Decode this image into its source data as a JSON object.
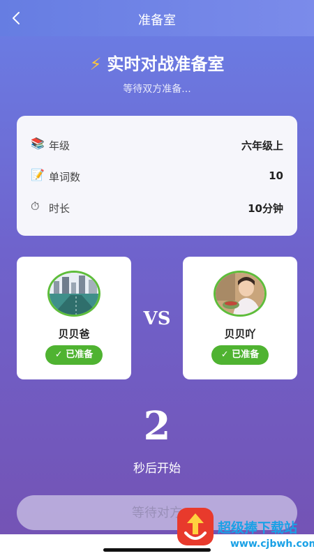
{
  "header": {
    "title": "准备室"
  },
  "hero": {
    "icon": "lightning-icon",
    "title": "实时对战准备室",
    "subtitle": "等待双方准备..."
  },
  "info": [
    {
      "icon": "books-icon",
      "label": "年级",
      "value": "六年级上"
    },
    {
      "icon": "memo-icon",
      "label": "单词数",
      "value": "10"
    },
    {
      "icon": "stopwatch-icon",
      "label": "时长",
      "value": "10分钟"
    }
  ],
  "players": [
    {
      "name": "贝贝爸",
      "status": "✓ 已准备"
    },
    {
      "name": "贝贝吖",
      "status": "✓ 已准备"
    }
  ],
  "vs_label": "VS",
  "countdown": {
    "value": "2",
    "label": "秒后开始"
  },
  "action": {
    "label": "等待对方"
  },
  "watermark": {
    "text": "超级捧下载站",
    "url": "www.cjbwh.com"
  },
  "colors": {
    "accent": "#6a7fe6",
    "ready": "#4fb331",
    "avatar_ring": "#5ebd3b"
  }
}
